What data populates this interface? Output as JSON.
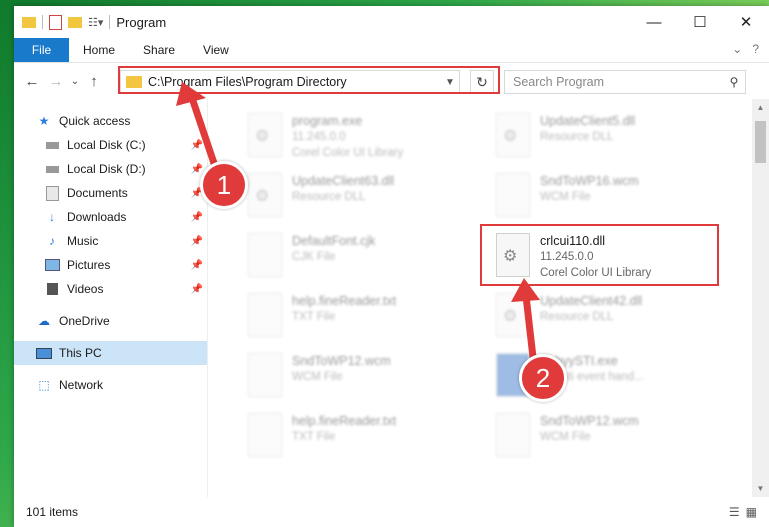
{
  "window": {
    "title": "Program",
    "controls": {
      "minimize": "—",
      "maximize": "☐",
      "close": "✕"
    }
  },
  "ribbon": {
    "tabs": [
      "File",
      "Home",
      "Share",
      "View"
    ],
    "right_icons": {
      "collapse": "⌄",
      "help": "?"
    }
  },
  "nav": {
    "back": "←",
    "forward": "→",
    "recent": "⌄",
    "up": "↑",
    "address": "C:\\Program Files\\Program Directory",
    "search_placeholder": "Search Program",
    "refresh": "↻"
  },
  "sidebar": {
    "items": [
      {
        "label": "Quick access",
        "icon": "star-icon",
        "pinned": false
      },
      {
        "label": "Local Disk (C:)",
        "icon": "drive-icon",
        "pinned": true
      },
      {
        "label": "Local Disk (D:)",
        "icon": "drive-icon",
        "pinned": true
      },
      {
        "label": "Documents",
        "icon": "documents-icon",
        "pinned": true
      },
      {
        "label": "Downloads",
        "icon": "download-icon",
        "pinned": true
      },
      {
        "label": "Music",
        "icon": "music-icon",
        "pinned": true
      },
      {
        "label": "Pictures",
        "icon": "pictures-icon",
        "pinned": true
      },
      {
        "label": "Videos",
        "icon": "videos-icon",
        "pinned": true
      },
      {
        "label": "OneDrive",
        "icon": "cloud-icon",
        "pinned": false
      },
      {
        "label": "This PC",
        "icon": "computer-icon",
        "pinned": false
      },
      {
        "label": "Network",
        "icon": "network-icon",
        "pinned": false
      }
    ]
  },
  "files": [
    {
      "name": "program.exe",
      "line2": "11.245.0.0",
      "line3": "Corel Color UI Library"
    },
    {
      "name": "UpdateClient5.dll",
      "line2": "Resource DLL",
      "line3": ""
    },
    {
      "name": "UpdateClient63.dll",
      "line2": "Resource DLL",
      "line3": ""
    },
    {
      "name": "SndToWP16.wcm",
      "line2": "WCM File",
      "line3": ""
    },
    {
      "name": "DefaultFont.cjk",
      "line2": "CJK File",
      "line3": ""
    },
    {
      "name": "crlcui110.dll",
      "line2": "11.245.0.0",
      "line3": "Corel Color UI Library"
    },
    {
      "name": "help.fineReader.txt",
      "line2": "TXT File",
      "line3": ""
    },
    {
      "name": "UpdateClient42.dll",
      "line2": "Resource DLL",
      "line3": ""
    },
    {
      "name": "SndToWP12.wcm",
      "line2": "WCM File",
      "line3": ""
    },
    {
      "name": "AbbyySTI.exe",
      "line2": "...ry sti event hand...",
      "line3": ""
    },
    {
      "name": "help.fineReader.txt",
      "line2": "TXT File",
      "line3": ""
    },
    {
      "name": "SndToWP12.wcm",
      "line2": "WCM File",
      "line3": ""
    }
  ],
  "status": {
    "item_count": "101 items"
  },
  "annotations": {
    "step1": "1",
    "step2": "2",
    "color": "#e03a3a"
  }
}
